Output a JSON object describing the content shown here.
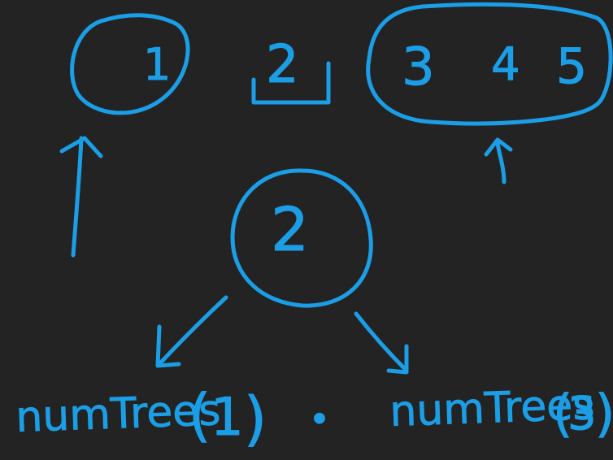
{
  "colors": {
    "background": "#232323",
    "ink": "#1b9ee6"
  },
  "diagram": {
    "top_row": {
      "left_item": "1",
      "root_item": "2",
      "right_items": [
        "3",
        "4",
        "5"
      ]
    },
    "tree": {
      "root_label": "2",
      "left_call": {
        "fn": "numTrees",
        "open": "(",
        "arg": "1",
        "close": ")"
      },
      "operator_symbol": "•",
      "right_call": {
        "fn": "numTrees",
        "open": "(",
        "arg": "3",
        "close": ")"
      }
    }
  }
}
